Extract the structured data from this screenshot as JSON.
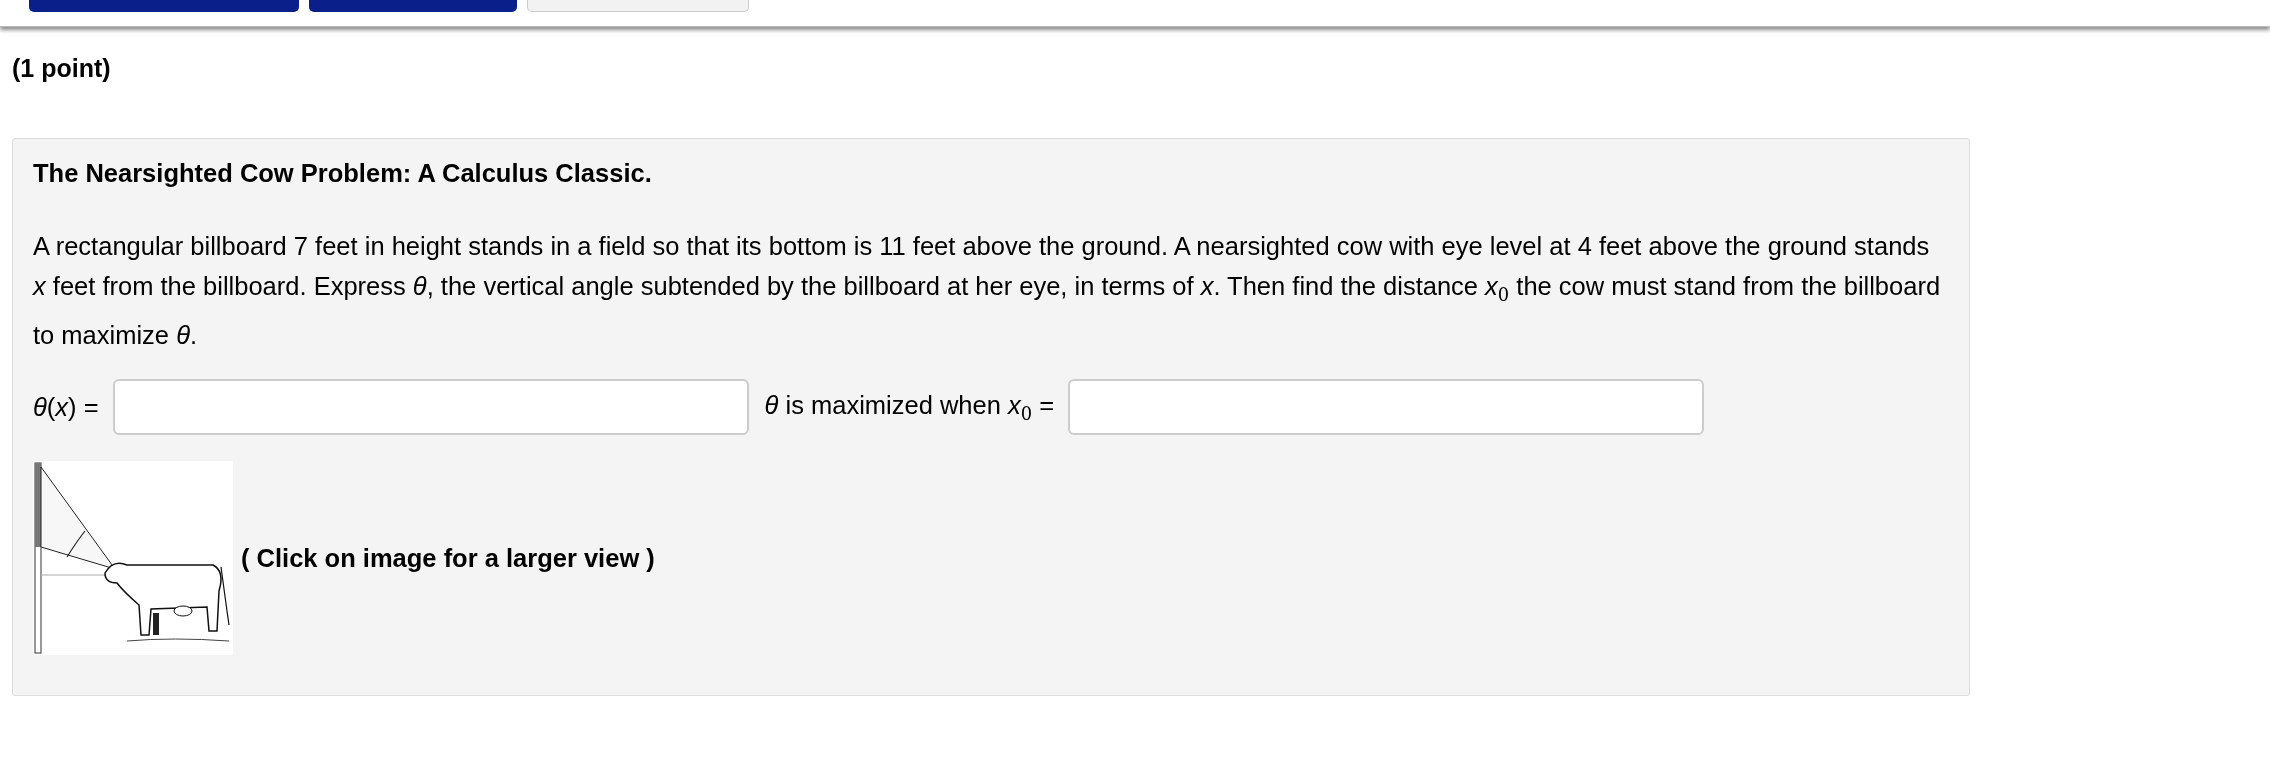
{
  "top_bar": {
    "buttons": [
      {
        "kind": "primary"
      },
      {
        "kind": "primary"
      },
      {
        "kind": "secondary"
      }
    ]
  },
  "points": "(1 point)",
  "problem": {
    "title": "The Nearsighted Cow Problem: A Calculus Classic.",
    "text": "A rectangular billboard 7 feet in height stands in a field so that its bottom is 11 feet above the ground. A nearsighted cow with eye level at 4 feet above the ground stands *x* feet from the billboard. Express *θ*, the vertical angle subtended by the billboard at her eye, in terms of *x*. Then find the distance *x*$_{0}$ the cow must stand from the billboard to maximize *θ*.",
    "answers": [
      {
        "label": "*θ*(*x*) ="
      },
      {
        "label": "*θ* is maximized when *x*$_{0}$ ="
      }
    ],
    "figure": {
      "kind": "picture",
      "caption": "( Click on image for a larger view )"
    }
  }
}
